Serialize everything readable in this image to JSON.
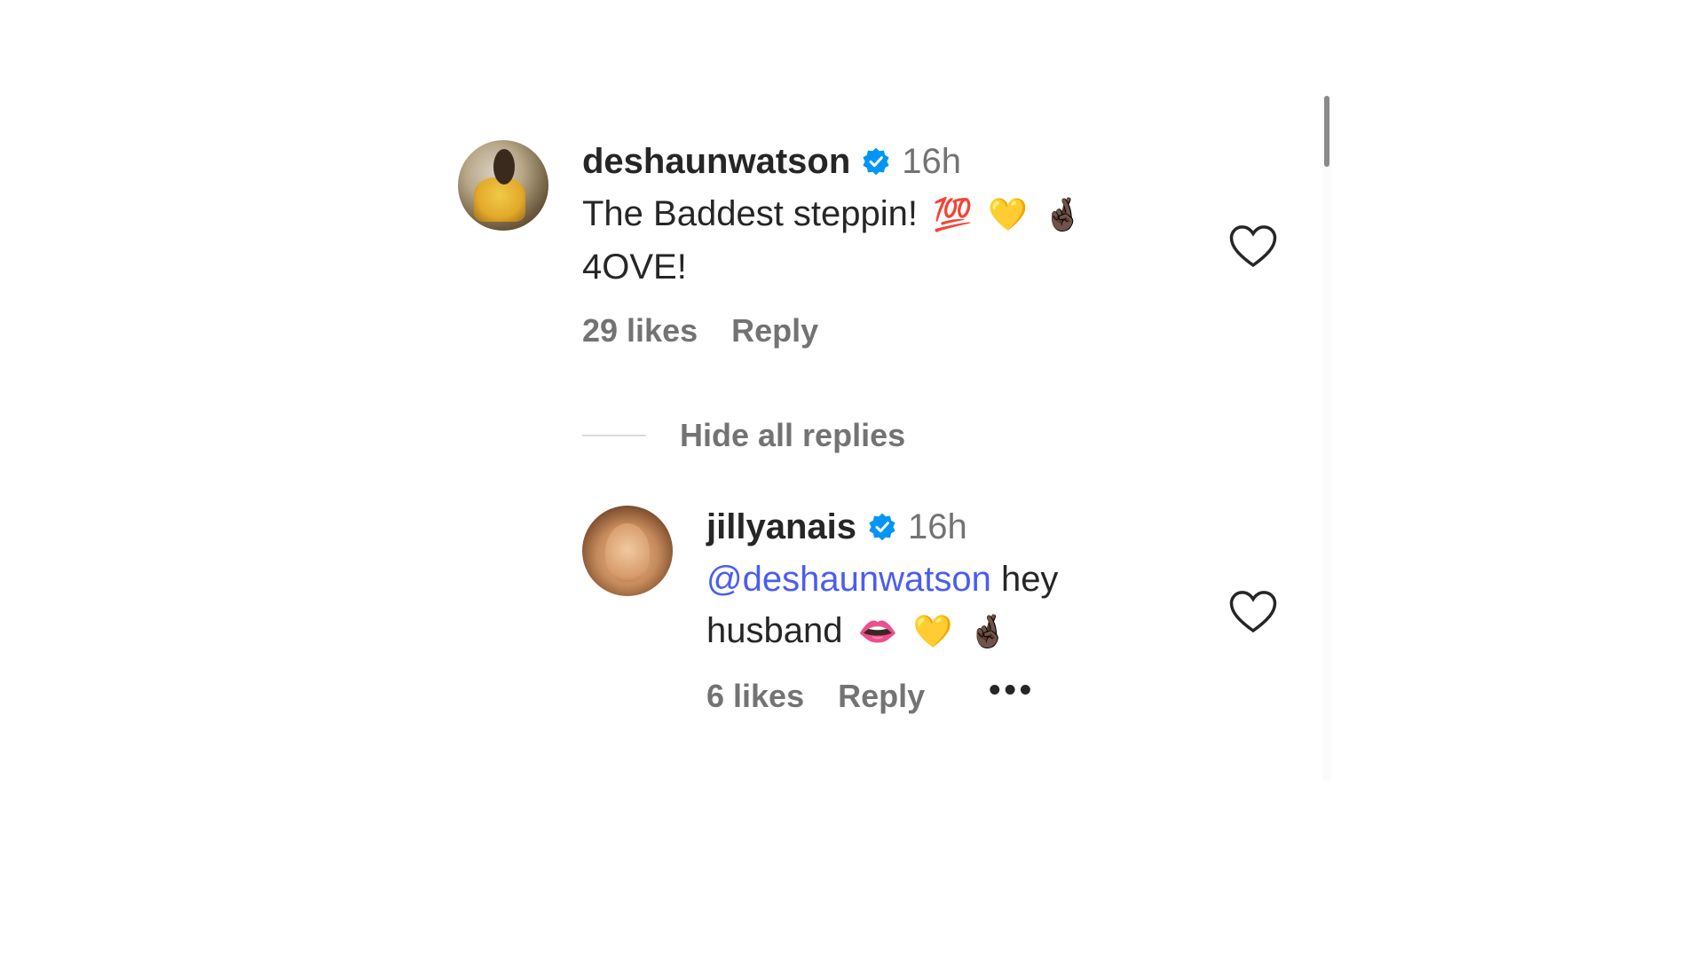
{
  "comments": [
    {
      "username": "deshaunwatson",
      "time": "16h",
      "text": "The Baddest steppin!",
      "emojis": [
        "💯",
        "💛",
        "🤞🏿"
      ],
      "text_line2": "4OVE!",
      "likes": "29 likes",
      "reply_label": "Reply"
    }
  ],
  "replies_toggle": "Hide all replies",
  "replies": [
    {
      "username": "jillyanais",
      "time": "16h",
      "mention": "@deshaunwatson",
      "text": " hey husband",
      "emojis": [
        "👄",
        "💛",
        "🤞🏿"
      ],
      "likes": "6 likes",
      "reply_label": "Reply",
      "more": "•••"
    }
  ],
  "icons": {
    "verified": "verified-badge-icon",
    "like": "heart-icon",
    "more": "more-options-icon"
  },
  "colors": {
    "verified": "#0095f6",
    "mention": "#4a5df0",
    "secondary_text": "#737373"
  }
}
